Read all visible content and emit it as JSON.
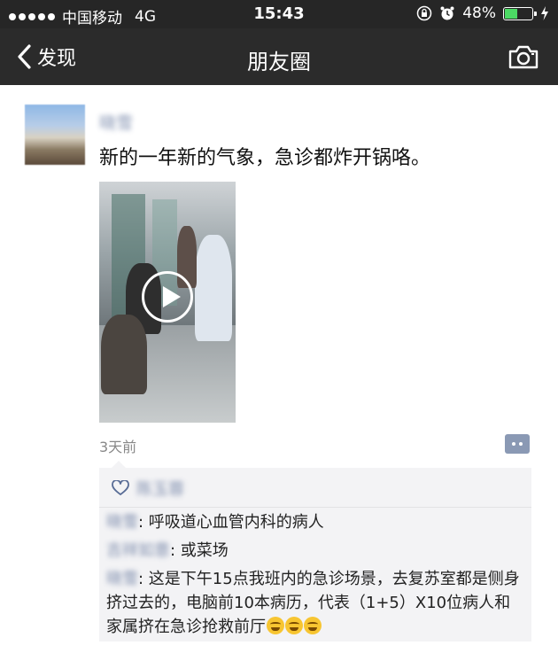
{
  "status_bar": {
    "carrier": "中国移动",
    "network": "4G",
    "time": "15:43",
    "battery": "48%",
    "battery_level": 0.48,
    "signal_dots": 5
  },
  "nav": {
    "back_label": "发现",
    "title": "朋友圈",
    "camera_icon": "camera-icon"
  },
  "post": {
    "author": "晓雪",
    "text": "新的一年新的气象，急诊都炸开锅咯。",
    "time_ago": "3天前",
    "video_icon": "play-icon"
  },
  "interactions": {
    "likes": "陈玉蓉",
    "comments": [
      {
        "name": "晓雪",
        "text": "呼吸道心血管内科的病人"
      },
      {
        "name": "吉祥如意",
        "text": "或菜场"
      },
      {
        "name": "晓雪",
        "text": "这是下午15点我班内的急诊场景，去复苏室都是侧身挤过去的，电脑前10本病历，代表（1+5）X10位病人和家属挤在急诊抢救前厅"
      }
    ]
  },
  "colors": {
    "nav_bg": "#2b2b2b",
    "name_blue": "#576b95",
    "panel_bg": "#f3f3f5",
    "battery_green": "#4cd964"
  }
}
